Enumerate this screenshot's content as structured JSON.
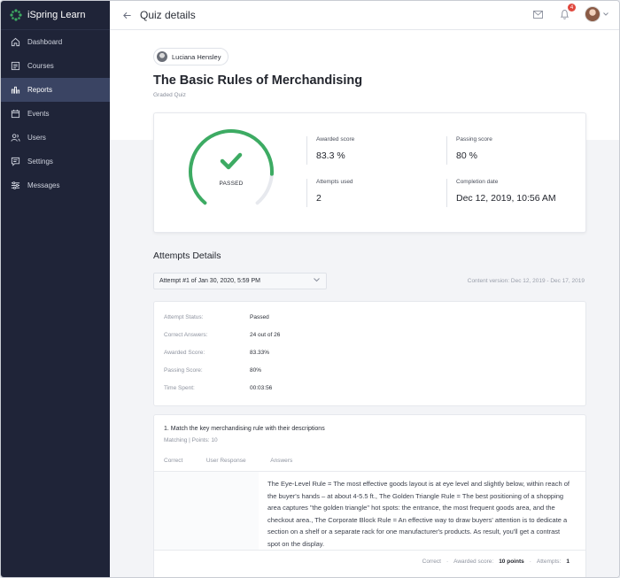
{
  "app": {
    "brand": "iSpring Learn"
  },
  "sidebar": {
    "items": [
      {
        "label": "Dashboard",
        "icon": "home-icon"
      },
      {
        "label": "Courses",
        "icon": "courses-icon"
      },
      {
        "label": "Reports",
        "icon": "chart-icon",
        "active": true
      },
      {
        "label": "Events",
        "icon": "calendar-icon"
      },
      {
        "label": "Users",
        "icon": "users-icon"
      },
      {
        "label": "Settings",
        "icon": "settings-icon"
      },
      {
        "label": "Messages",
        "icon": "sliders-icon"
      }
    ]
  },
  "header": {
    "title": "Quiz details",
    "notification_count": "4"
  },
  "user": {
    "name": "Luciana Hensley"
  },
  "quiz": {
    "title": "The Basic Rules of Merchandising",
    "type": "Graded Quiz"
  },
  "summary": {
    "status": "PASSED",
    "progress": 0.833,
    "awarded_label": "Awarded score",
    "awarded_value": "83.3 %",
    "passing_label": "Passing score",
    "passing_value": "80 %",
    "attempts_label": "Attempts used",
    "attempts_value": "2",
    "completion_label": "Completion date",
    "completion_value": "Dec 12, 2019, 10:56 AM"
  },
  "attempts": {
    "section_title": "Attempts Details",
    "selected": "Attempt #1 of Jan 30, 2020, 5:59 PM",
    "content_version": "Content version: Dec 12, 2019 - Dec 17, 2019",
    "rows": [
      {
        "key": "Attempt Status:",
        "value": "Passed"
      },
      {
        "key": "Correct Answers:",
        "value": "24 out of 26"
      },
      {
        "key": "Awarded Score:",
        "value": "83.33%"
      },
      {
        "key": "Passing Score:",
        "value": "80%"
      },
      {
        "key": "Time Spent:",
        "value": "00:03:56"
      }
    ]
  },
  "question": {
    "title": "1. Match the key merchandising rule with their descriptions",
    "meta": "Matching | Points: 10",
    "col_correct": "Correct",
    "col_response": "User Response",
    "col_answers": "Answers",
    "answer": "The Eye-Level Rule = The most effective goods layout is at eye level and slightly below, within reach of the buyer's hands – at about 4-5.5 ft., The Golden Triangle Rule = The best positioning of a shopping area captures \"the golden triangle\" hot spots: the entrance, the most frequent goods area, and the checkout area., The Corporate Block Rule = An effective way to draw buyers' attention is to dedicate a section on a shelf or a separate rack for one manufacturer's products. As result, you'll get a contrast spot on the display.",
    "footer_status": "Correct",
    "footer_score_label": "Awarded score:",
    "footer_score_value": "10 points",
    "footer_attempts_label": "Attempts:",
    "footer_attempts_value": "1"
  },
  "colors": {
    "accent_green": "#3dab63",
    "sidebar_bg": "#1f2438",
    "sidebar_active": "#3a4463"
  }
}
